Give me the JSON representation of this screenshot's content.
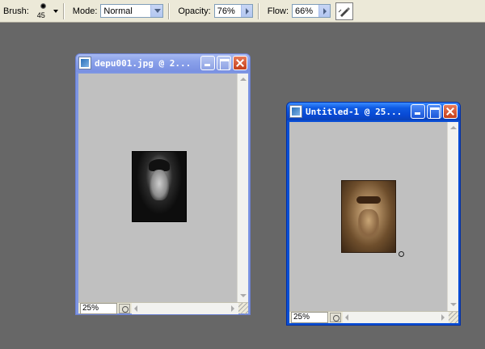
{
  "options_bar": {
    "brush_label": "Brush:",
    "brush_size": "45",
    "mode_label": "Mode:",
    "mode_value": "Normal",
    "opacity_label": "Opacity:",
    "opacity_value": "76%",
    "flow_label": "Flow:",
    "flow_value": "66%"
  },
  "windows": [
    {
      "title": "depu001.jpg @ 2...",
      "zoom": "25%",
      "active": false
    },
    {
      "title": "Untitled-1 @ 25...",
      "zoom": "25%",
      "active": true
    }
  ],
  "colors": {
    "workspace": "#676767",
    "canvas": "#c0c0c0",
    "xp_titlebar_active": "#0a4fd6",
    "xp_titlebar_inactive": "#7d95e3"
  }
}
